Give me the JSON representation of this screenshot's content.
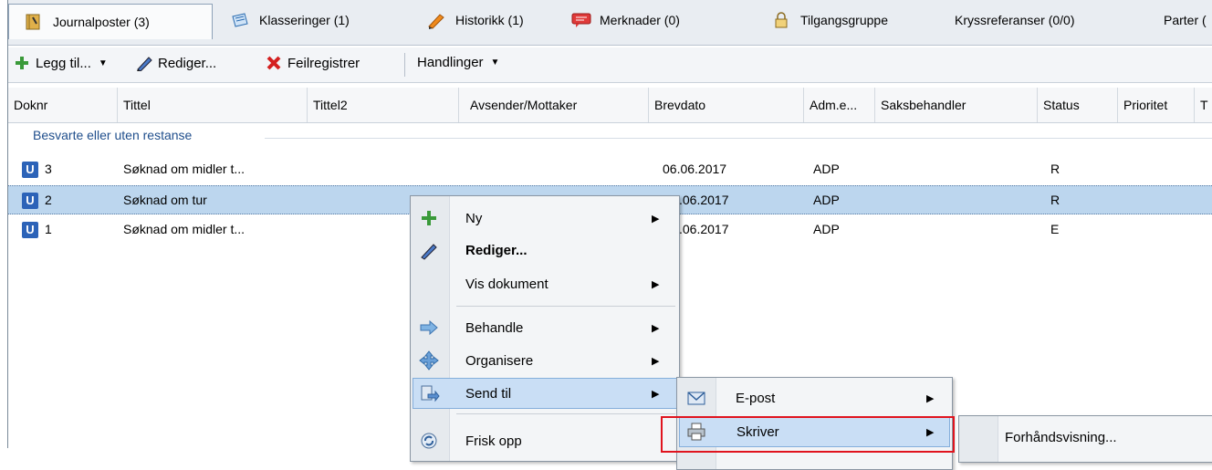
{
  "tabs": [
    {
      "label": "Journalposter (3)",
      "icon": "journal-icon",
      "active": true
    },
    {
      "label": "Klasseringer (1)",
      "icon": "folder-stack-icon"
    },
    {
      "label": "Historikk (1)",
      "icon": "pencil-history-icon"
    },
    {
      "label": "Merknader (0)",
      "icon": "comment-icon"
    },
    {
      "label": "Tilgangsgruppe",
      "icon": "lock-icon"
    },
    {
      "label": "Kryssreferanser (0/0)"
    },
    {
      "label": "Parter ("
    }
  ],
  "toolbar": {
    "add_label": "Legg til...",
    "edit_label": "Rediger...",
    "error_label": "Feilregistrer",
    "actions_label": "Handlinger"
  },
  "columns": [
    "Doknr",
    "Tittel",
    "Tittel2",
    "Avsender/Mottaker",
    "Brevdato",
    "Adm.e...",
    "Saksbehandler",
    "Status",
    "Prioritet",
    "T"
  ],
  "group_label": "Besvarte eller uten restanse",
  "rows": [
    {
      "badge": "U",
      "doknr": "3",
      "tittel": "Søknad om midler t...",
      "brevdato": "06.06.2017",
      "adm": "ADP",
      "status": "R"
    },
    {
      "badge": "U",
      "doknr": "2",
      "tittel": "Søknad om tur",
      "brevdato": ".06.2017",
      "adm": "ADP",
      "status": "R"
    },
    {
      "badge": "U",
      "doknr": "1",
      "tittel": "Søknad om midler t...",
      "brevdato": ".06.2017",
      "adm": "ADP",
      "status": "E"
    }
  ],
  "context_menu": {
    "items": {
      "ny": "Ny",
      "rediger": "Rediger...",
      "vis": "Vis dokument",
      "behandle": "Behandle",
      "organisere": "Organisere",
      "send": "Send til",
      "frisk": "Frisk opp"
    }
  },
  "send_menu": {
    "epost": "E-post",
    "skriver": "Skriver"
  },
  "printer_menu": {
    "preview": "Forhåndsvisning..."
  },
  "colors": {
    "accent": "#2c63b8",
    "highlight": "#c9def5",
    "selection": "#bcd6ee",
    "callout": "#e0141e"
  }
}
